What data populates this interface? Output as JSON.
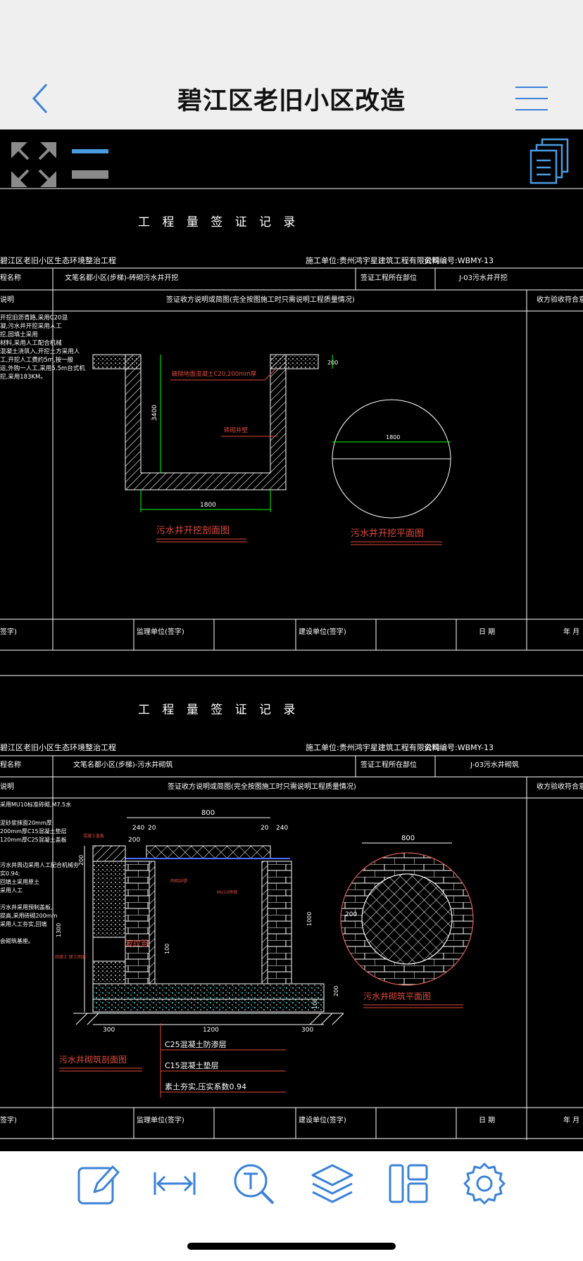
{
  "header": {
    "title": "碧江区老旧小区改造",
    "back_icon": "chevron-left-icon",
    "menu_icon": "hamburger-menu-icon"
  },
  "viewer_toolbar": {
    "fullscreen_icon": "expand-arrows-icon",
    "layers_toggle_icon": "layer-toggle-icon",
    "pages_icon": "document-stack-icon"
  },
  "sheet1": {
    "title": "工 程 量 签 证 记 录",
    "project": "碧江区老旧小区生态环境整治工程",
    "contractor": "施工单位:贵州鸿宇星建筑工程有限公司",
    "doc_no": "资料编号:WBMY-13",
    "name_label": "程名称",
    "name_value": "文笔名都小区(步梯)-砖砌污水井开挖",
    "location_label": "签证工程所在部位",
    "location_value": "J-03污水井开挖",
    "desc_label": "说明",
    "diagram_label": "签证收方说明或简图(完全按图施工时只需说明工程质量情况)",
    "acceptance_label": "收方验收符合意见",
    "notes": [
      "开挖旧沥青路,采用C20混",
      "凝,污水井开挖采用人工",
      "挖,回填土采用",
      "材料,采用人工配合机械",
      "混凝土浇筑入,开挖土方采用人",
      "工,开挖人工费约5m,按一般",
      "运,外购一人工,采用5.5m台式机",
      "挖,采用183KM。"
    ],
    "pit_label_1": "破除地面混凝土C20,200mm厚",
    "pit_label_2": "砖砌井壁",
    "dim_depth": "3400",
    "dim_width": "1800",
    "dim_slab": "200",
    "circle_dim": "1800",
    "section_caption": "污水井开挖剖面图",
    "plan_caption": "污水井开挖平面图",
    "sign_1": "签字)",
    "sign_2": "监理单位(签字)",
    "sign_3": "建设单位(签字)",
    "date": "日   期",
    "year": "年   月"
  },
  "sheet2": {
    "title": "工 程 量 签 证 记 录",
    "project": "碧江区老旧小区生态环境整治工程",
    "contractor": "施工单位:贵州鸿宇星建筑工程有限公司",
    "doc_no": "资料编号:WBMY-13",
    "name_label": "程名称",
    "name_value": "文笔名都小区(步梯)-污水井砌筑",
    "location_label": "签证工程所在部位",
    "location_value": "J-03污水井砌筑",
    "desc_label": "说明",
    "diagram_label": "签证收方说明或简图(完全按图施工时只需说明工程质量情况)",
    "acceptance_label": "收方验收符合意见",
    "notes": [
      "采用MU10标准砖砌,M7.5水",
      "泥砂浆抹面20mm厚;",
      "200mm厚C15混凝土垫层",
      "120mm厚C25混凝土盖板",
      "",
      "污水井周边采用人工配合机械夯",
      "实0.94;",
      "回填土采用原土",
      "采用人工",
      "",
      "污水井采用预制盖板,",
      "提高,采用砖砌200mm",
      "采用人工夯实,回填",
      "",
      "会砌筑基座。"
    ],
    "dim_800": "800",
    "dim_240a": "240",
    "dim_20a": "20",
    "dim_20b": "20",
    "dim_240b": "240",
    "dim_200": "200",
    "dim_200v": "200",
    "dim_1300": "1300",
    "dim_1000": "1000",
    "dim_300a": "300",
    "dim_1200": "1200",
    "dim_300b": "300",
    "dim_200b": "200",
    "dim_100": "100",
    "dim_right_200": "200",
    "dim_right_100": "100",
    "label_pipe": "波纹管",
    "label_small1": "混凝土盖板",
    "label_small2": "砖砌井壁",
    "label_small3": "MU10砖砌",
    "label_side": "回填土 原土回填",
    "circle_dim": "800",
    "circle_left": "200",
    "plan_caption": "污水井砌筑平面图",
    "section_caption": "污水井砌筑剖面图",
    "legend_1": "C25混凝土防渗层",
    "legend_2": "C15混凝土垫层",
    "legend_3": "素土夯实,压实系数0.94",
    "sign_1": "签字)",
    "sign_2": "监理单位(签字)",
    "sign_3": "建设单位(签字)",
    "date": "日   期",
    "year": "年   月"
  },
  "bottom_toolbar": [
    {
      "name": "edit-annotate-icon"
    },
    {
      "name": "measure-distance-icon"
    },
    {
      "name": "text-search-icon"
    },
    {
      "name": "layers-icon"
    },
    {
      "name": "layout-panels-icon"
    },
    {
      "name": "settings-gear-icon"
    }
  ],
  "colors": {
    "accent_blue": "#3b82d8",
    "cad_white": "#ffffff",
    "cad_red": "#e04a3c",
    "cad_green": "#00ff00",
    "cad_yellow": "#ffd700"
  }
}
